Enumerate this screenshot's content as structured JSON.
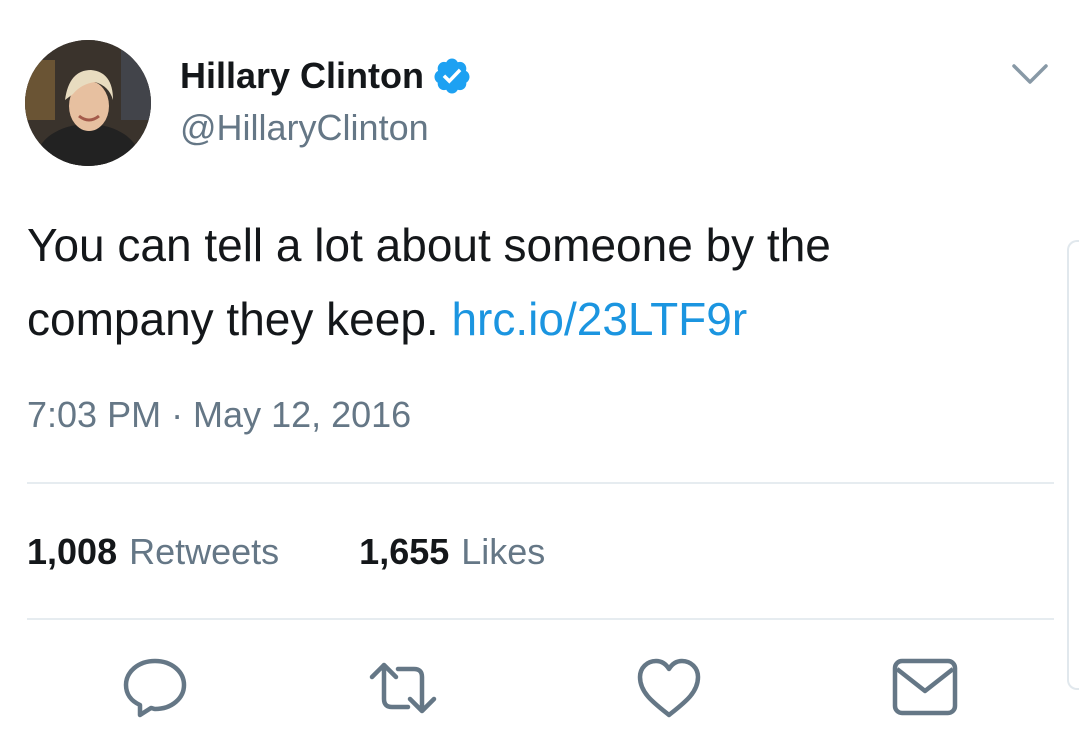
{
  "tweet": {
    "author": {
      "display_name": "Hillary Clinton",
      "handle": "@HillaryClinton",
      "verified": true,
      "avatar_icon": "profile-photo"
    },
    "text": "You can tell a lot about someone by the company they keep.",
    "link": "hrc.io/23LTF9r",
    "timestamp": "7:03 PM · May 12, 2016",
    "stats": {
      "retweets_count": "1,008",
      "retweets_label": "Retweets",
      "likes_count": "1,655",
      "likes_label": "Likes"
    },
    "actions": [
      {
        "name": "reply",
        "icon": "reply-icon"
      },
      {
        "name": "retweet",
        "icon": "retweet-icon"
      },
      {
        "name": "like",
        "icon": "heart-icon"
      },
      {
        "name": "direct-message",
        "icon": "envelope-icon"
      }
    ]
  },
  "colors": {
    "link": "#1b95e0",
    "verified": "#1da1f2",
    "secondary_text": "#657786",
    "primary_text": "#14171a",
    "icon": "#657786",
    "divider": "#e6ecf0"
  }
}
